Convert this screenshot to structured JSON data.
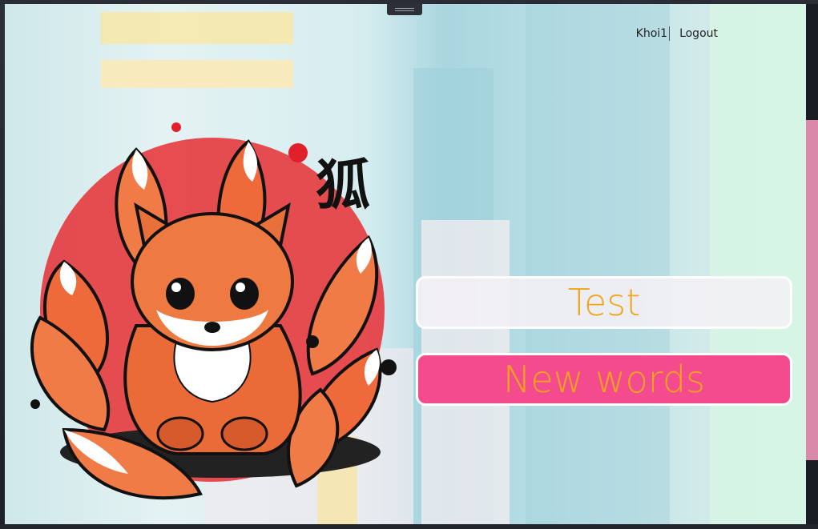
{
  "header": {
    "username": "Khoi1",
    "logout_label": "Logout"
  },
  "illustration": {
    "kanji": "狐"
  },
  "menu": {
    "test_label": "Test",
    "new_words_label": "New words"
  },
  "colors": {
    "button_text": "#f2a51a",
    "new_words_bg": "#f44b8e",
    "test_bg": "#f2f0f4"
  }
}
